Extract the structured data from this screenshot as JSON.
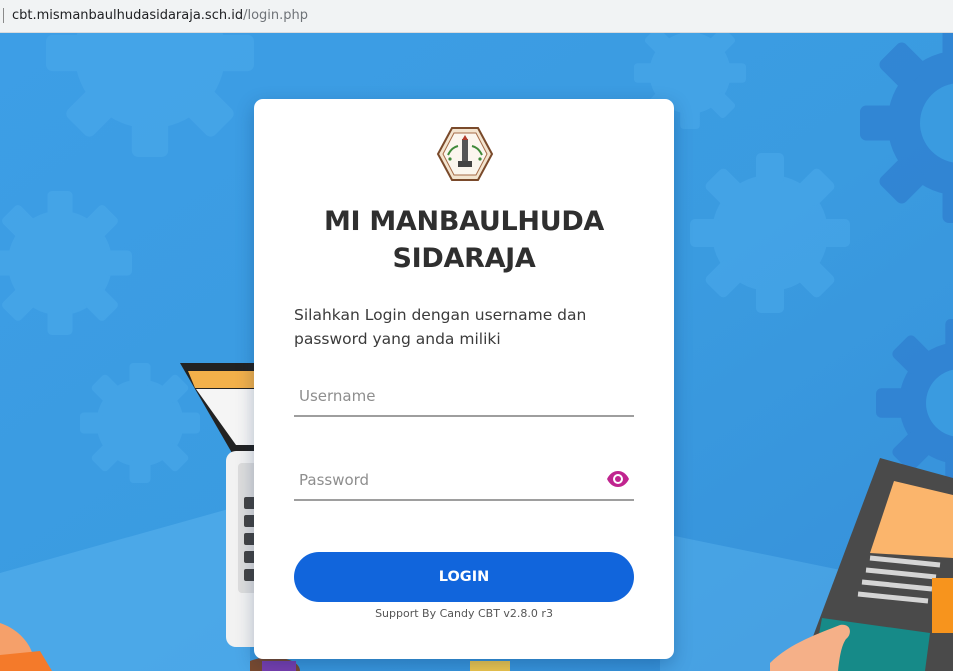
{
  "browser": {
    "url_domain": "cbt.mismanbaulhudasidaraja.sch.id",
    "url_path": "/login.php"
  },
  "login": {
    "title_line1": "MI MANBAULHUDA",
    "title_line2": "SIDARAJA",
    "instruction": "Silahkan Login dengan username dan password yang anda miliki",
    "username_placeholder": "Username",
    "password_placeholder": "Password",
    "button_label": "LOGIN",
    "footer": "Support By Candy CBT v2.8.0 r3"
  },
  "colors": {
    "background": "#3a9be0",
    "button": "#1165dc",
    "eye_icon": "#c0248f",
    "title": "#2f2f2f"
  },
  "icons": {
    "logo": "school-emblem-icon",
    "password_toggle": "eye-icon"
  }
}
